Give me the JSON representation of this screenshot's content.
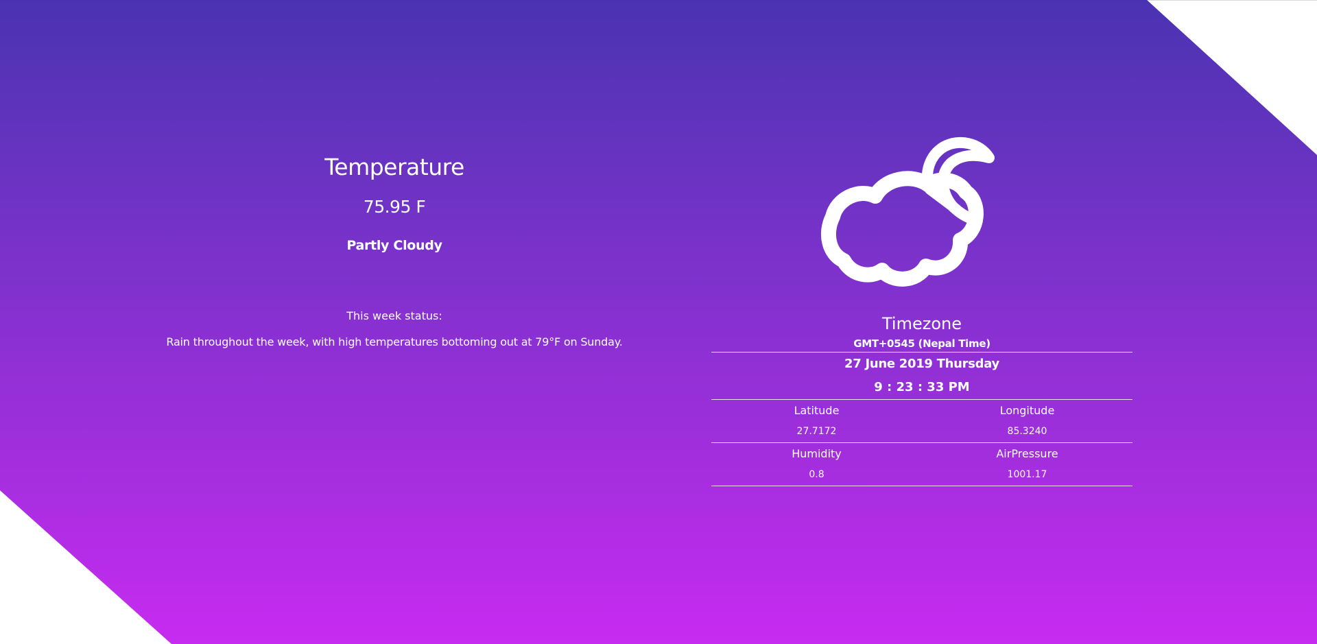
{
  "weather": {
    "title": "Temperature",
    "temperature": "75.95 F",
    "condition": "Partly Cloudy",
    "week_label": "This week status:",
    "week_status": "Rain throughout the week, with high temperatures bottoming out at 79°F on Sunday.",
    "icon": "partly-cloudy-night-icon"
  },
  "timezone": {
    "title": "Timezone",
    "value": "GMT+0545 (Nepal Time)",
    "date": "27 June 2019 Thursday",
    "time": "9 : 23 : 33 PM"
  },
  "details": {
    "latitude_label": "Latitude",
    "latitude_value": "27.7172",
    "longitude_label": "Longitude",
    "longitude_value": "85.3240",
    "humidity_label": "Humidity",
    "humidity_value": "0.8",
    "airpressure_label": "AirPressure",
    "airpressure_value": "1001.17"
  },
  "colors": {
    "gradient_top": "#4a33b2",
    "gradient_bottom": "#c72bf0",
    "text": "#ffffff"
  }
}
